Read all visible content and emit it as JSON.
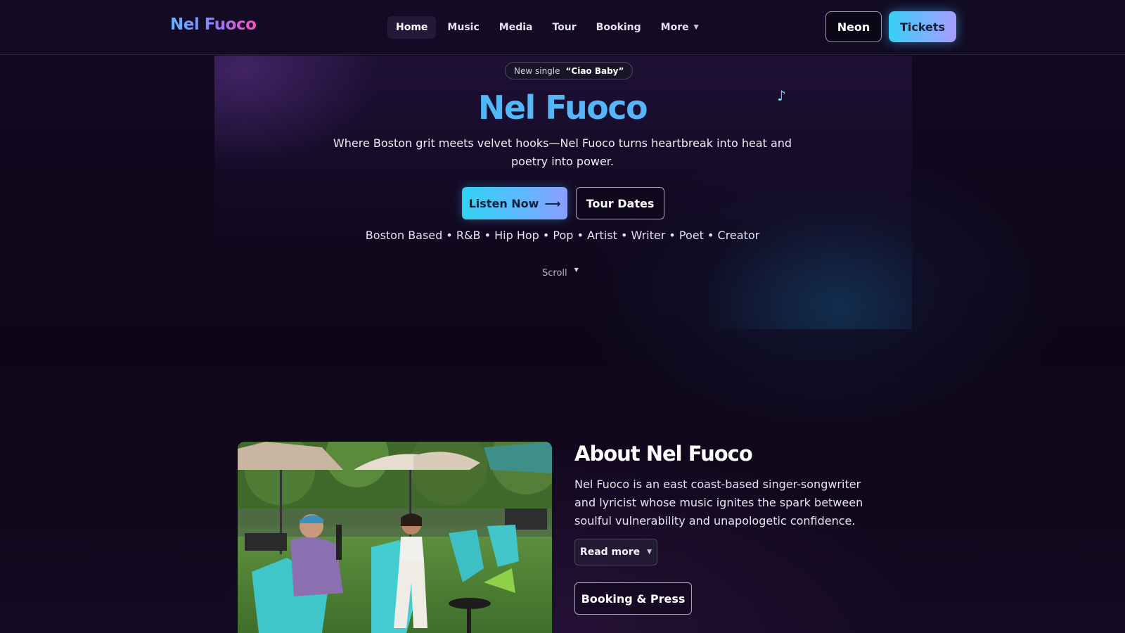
{
  "nav": {
    "logo": "Nel Fuoco",
    "items": [
      {
        "label": "Home",
        "active": true
      },
      {
        "label": "Music"
      },
      {
        "label": "Media"
      },
      {
        "label": "Tour"
      },
      {
        "label": "Booking"
      },
      {
        "label": "More",
        "has_dropdown": true
      }
    ],
    "theme_button": "Neon",
    "tickets_button": "Tickets"
  },
  "hero": {
    "pill_prefix": "New single",
    "pill_song": "“Ciao Baby”",
    "title": "Nel Fuoco",
    "subtitle": "Where Boston grit meets velvet hooks—Nel Fuoco turns heartbreak into heat and poetry into power.",
    "listen_button": "Listen Now",
    "listen_arrow": "⟶",
    "tour_button": "Tour Dates",
    "tags": "Boston Based • R&B • Hip Hop • Pop • Artist • Writer • Poet • Creator",
    "scroll_label": "Scroll",
    "note_glyph": "♪"
  },
  "about": {
    "title": "About Nel Fuoco",
    "text": "Nel Fuoco is an east coast-based singer-songwriter and lyricist whose music ignites the spark between soulful vulnerability and unapologetic confidence.",
    "read_more": "Read more",
    "booking_button": "Booking & Press"
  },
  "colors": {
    "accent_cyan": "#2fc8f0",
    "accent_violet": "#8d7bff",
    "accent_pink": "#ff4fc0",
    "background": "#0f0719"
  }
}
